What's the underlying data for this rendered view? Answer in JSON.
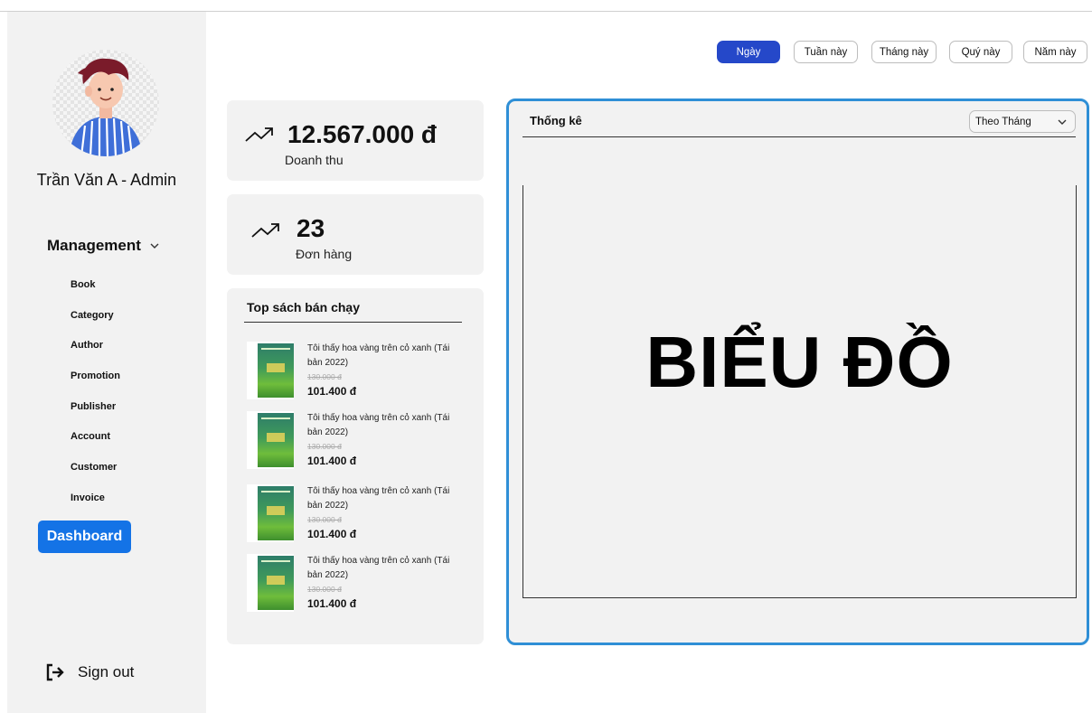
{
  "user": {
    "name": "Trần Văn A - Admin"
  },
  "sidebar": {
    "section_label": "Management",
    "items": [
      {
        "label": "Book"
      },
      {
        "label": "Category"
      },
      {
        "label": "Author"
      },
      {
        "label": "Promotion"
      },
      {
        "label": "Publisher"
      },
      {
        "label": "Account"
      },
      {
        "label": "Customer"
      },
      {
        "label": "Invoice"
      }
    ],
    "active_item": "Dashboard",
    "signout_label": "Sign out"
  },
  "filters": {
    "items": [
      {
        "label": "Ngày",
        "active": true
      },
      {
        "label": "Tuần này",
        "active": false
      },
      {
        "label": "Tháng này",
        "active": false
      },
      {
        "label": "Quý này",
        "active": false
      },
      {
        "label": "Năm này",
        "active": false
      }
    ]
  },
  "stats": {
    "revenue": {
      "value": "12.567.000 đ",
      "label": "Doanh thu"
    },
    "orders": {
      "value": "23",
      "label": "Đơn hàng"
    }
  },
  "top_books": {
    "title": "Top sách bán chạy",
    "items": [
      {
        "title": "Tôi thấy hoa vàng trên cỏ xanh (Tái bản 2022)",
        "old_price": "130.000 đ",
        "price": "101.400 đ"
      },
      {
        "title": "Tôi thấy hoa vàng trên cỏ xanh (Tái bản 2022)",
        "old_price": "130.000 đ",
        "price": "101.400 đ"
      },
      {
        "title": "Tôi thấy hoa vàng trên cỏ xanh (Tái bản 2022)",
        "old_price": "130.000 đ",
        "price": "101.400 đ"
      },
      {
        "title": "Tôi thấy hoa vàng trên cỏ xanh (Tái bản 2022)",
        "old_price": "130.000 đ",
        "price": "101.400 đ"
      }
    ]
  },
  "statistics": {
    "title": "Thống kê",
    "select_value": "Theo Tháng",
    "chart_placeholder": "BIỂU ĐỒ"
  },
  "colors": {
    "primary": "#1473e6",
    "filter_active": "#2548c9",
    "panel_border": "#2f8fd6",
    "card_bg": "#f2f2f2"
  }
}
